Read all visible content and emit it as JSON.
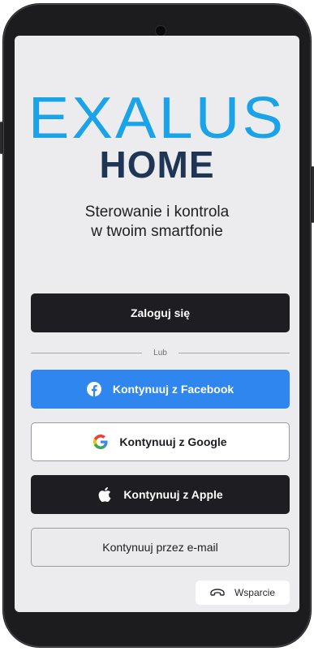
{
  "brand": {
    "logo_top": "EXALUS",
    "logo_bottom": "HOME",
    "tagline_line1": "Sterowanie i kontrola",
    "tagline_line2": "w twoim smartfonie"
  },
  "auth": {
    "login_label": "Zaloguj się",
    "divider_label": "Lub",
    "facebook_label": "Kontynuuj z Facebook",
    "google_label": "Kontynuuj z Google",
    "apple_label": "Kontynuuj z Apple",
    "email_label": "Kontynuuj przez e-mail"
  },
  "support": {
    "label": "Wsparcie",
    "icon": "phone-icon"
  },
  "colors": {
    "brand_blue": "#1aa3e8",
    "brand_navy": "#1e3555",
    "facebook_blue": "#2f86ee",
    "dark_button": "#1d1d22"
  }
}
